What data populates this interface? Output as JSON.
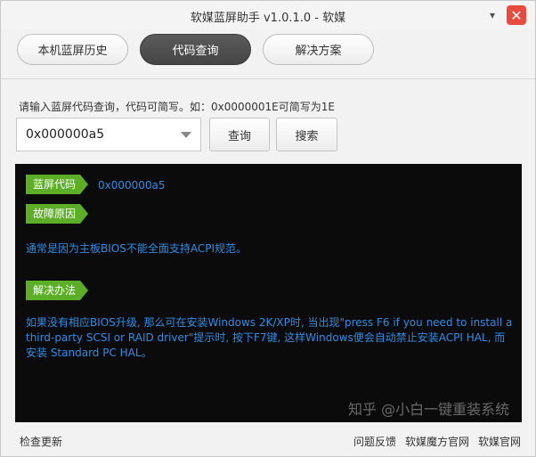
{
  "window": {
    "title": "软媒蓝屏助手 v1.0.1.0 - 软媒",
    "minimize_glyph": "▾",
    "close_glyph": "✕"
  },
  "tabs": [
    {
      "label": "本机蓝屏历史",
      "active": false
    },
    {
      "label": "代码查询",
      "active": true
    },
    {
      "label": "解决方案",
      "active": false
    }
  ],
  "query": {
    "hint": "请输入蓝屏代码查询，代码可简写。如：0x0000001E可简写为1E",
    "value": "0x000000a5",
    "query_button": "查询",
    "search_button": "搜索"
  },
  "result": {
    "code_tag": "蓝屏代码",
    "code_value": "0x000000a5",
    "cause_tag": "故障原因",
    "cause_text": "通常是因为主板BIOS不能全面支持ACPI规范。",
    "solution_tag": "解决办法",
    "solution_text": "如果没有相应BIOS升级, 那么可在安装Windows 2K/XP时, 当出现\"press F6 if you need to install a third-party SCSI or RAID driver\"提示时, 按下F7键, 这样Windows便会自动禁止安装ACPI HAL, 而安装 Standard PC HAL。"
  },
  "footer": {
    "check_update": "检查更新",
    "links": [
      "问题反馈",
      "软媒魔方官网",
      "软媒官网"
    ]
  },
  "watermark": "知乎 @小白一键重装系统",
  "colors": {
    "tag_green": "#5dae27",
    "text_blue": "#2f8de4",
    "panel_bg": "#0b0b0b",
    "active_tab": "#4f4f4f",
    "close_red": "#e84a3d"
  }
}
